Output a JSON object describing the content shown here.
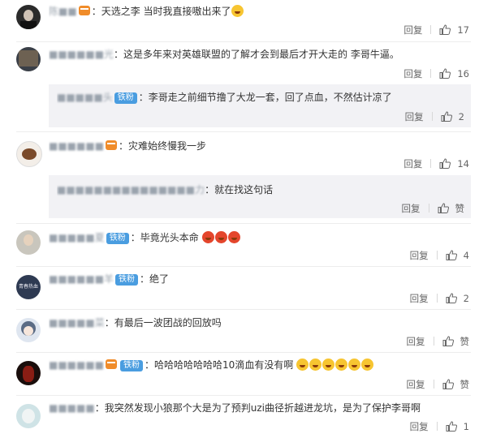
{
  "comments": [
    {
      "name": "陈■■",
      "text": "天选之李 当时我直接嗷出来了",
      "reply": "回复",
      "likes": "17"
    },
    {
      "name": "■■■■■■光",
      "text": "这是多年来对英雄联盟的了解才会到最后才开大走的 李哥牛逼。",
      "reply": "回复",
      "likes": "16",
      "sub": {
        "name": "■■■■■头",
        "badge": "铁粉",
        "text": "李哥走之前细节撸了大龙一套，回了点血，不然估计凉了",
        "reply": "回复",
        "likes": "2"
      }
    },
    {
      "name": "■■■■■■",
      "text": "灾难始终慢我一步",
      "reply": "回复",
      "likes": "14",
      "sub": {
        "name": "■■■■■■■■■■■■■■■力",
        "text": "就在找这句话",
        "reply": "回复",
        "likes": "赞"
      }
    },
    {
      "name": "■■■■■夏",
      "badge": "铁粉",
      "text": "毕竟光头本命",
      "reply": "回复",
      "likes": "4"
    },
    {
      "name": "■■■■■■羊",
      "badge": "铁粉",
      "text": "绝了",
      "reply": "回复",
      "likes": "2"
    },
    {
      "name": "■■■■■菜",
      "text": "有最后一波团战的回放吗",
      "reply": "回复",
      "likes": "赞"
    },
    {
      "name": "■■■■■■",
      "badge": "铁粉",
      "text": "哈哈哈哈哈哈哈10滴血有没有啊",
      "reply": "回复",
      "likes": "赞"
    },
    {
      "name": "■■■■■",
      "text": "我突然发现小狼那个大是为了预判uzi曲径折越进龙坑，是为了保护李哥啊",
      "reply": "回复",
      "likes": "1"
    }
  ],
  "avatar_text": "青春热血"
}
